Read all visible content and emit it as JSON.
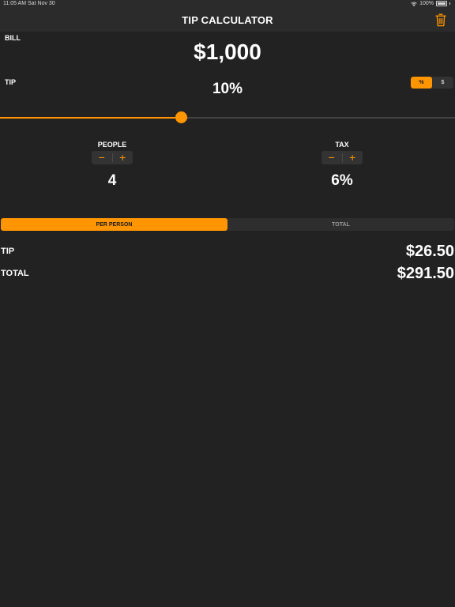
{
  "status_bar": {
    "time_date": "11:05 AM   Sat Nov 30",
    "battery": "100%"
  },
  "header": {
    "title": "TIP CALCULATOR",
    "trash_icon": "trash-icon"
  },
  "bill": {
    "label": "BILL",
    "value": "$1,000"
  },
  "tip": {
    "label": "TIP",
    "value": "10%",
    "mode_options": [
      "%",
      "$"
    ],
    "selected_mode": "%",
    "slider_fraction": 0.4
  },
  "people": {
    "label": "PEOPLE",
    "minus": "−",
    "plus": "+",
    "value": "4"
  },
  "tax": {
    "label": "TAX",
    "minus": "−",
    "plus": "+",
    "value": "6%"
  },
  "view_toggle": {
    "options": [
      "PER PERSON",
      "TOTAL"
    ],
    "selected": "PER PERSON"
  },
  "results": {
    "tip_label": "TIP",
    "tip_value": "$26.50",
    "total_label": "TOTAL",
    "total_value": "$291.50"
  },
  "colors": {
    "accent": "#ff9500",
    "background": "#222222",
    "bar": "#2b2b2b"
  }
}
